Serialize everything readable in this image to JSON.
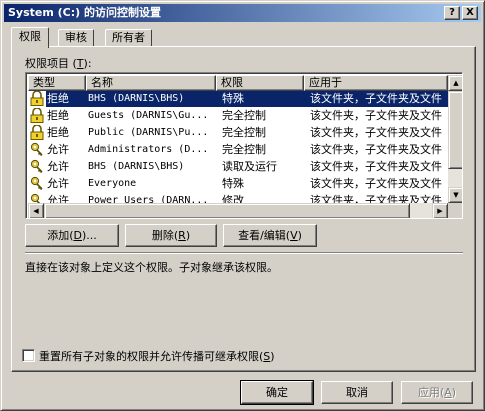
{
  "window": {
    "title": "System (C:) 的访问控制设置",
    "help_glyph": "?",
    "close_glyph": "X"
  },
  "tabs": [
    {
      "label": "权限",
      "active": true
    },
    {
      "label": "审核",
      "active": false
    },
    {
      "label": "所有者",
      "active": false
    }
  ],
  "permissions": {
    "list_label_prefix": "权限项目 (",
    "list_label_key": "T",
    "list_label_suffix": "):",
    "columns": [
      "类型",
      "名称",
      "权限",
      "应用于"
    ],
    "rows": [
      {
        "icon": "lock-icon",
        "type": "拒绝",
        "name": "BHS (DARNIS\\BHS)",
        "permission": "特殊",
        "apply_to": "该文件夹，子文件夹及文件",
        "selected": true
      },
      {
        "icon": "lock-icon",
        "type": "拒绝",
        "name": "Guests (DARNIS\\Gu...",
        "permission": "完全控制",
        "apply_to": "该文件夹，子文件夹及文件",
        "selected": false
      },
      {
        "icon": "lock-icon",
        "type": "拒绝",
        "name": "Public (DARNIS\\Pu...",
        "permission": "完全控制",
        "apply_to": "该文件夹，子文件夹及文件",
        "selected": false
      },
      {
        "icon": "key-icon",
        "type": "允许",
        "name": "Administrators (D...",
        "permission": "完全控制",
        "apply_to": "该文件夹，子文件夹及文件",
        "selected": false
      },
      {
        "icon": "key-icon",
        "type": "允许",
        "name": "BHS (DARNIS\\BHS)",
        "permission": "读取及运行",
        "apply_to": "该文件夹，子文件夹及文件",
        "selected": false
      },
      {
        "icon": "key-icon",
        "type": "允许",
        "name": "Everyone",
        "permission": "特殊",
        "apply_to": "该文件夹，子文件夹及文件",
        "selected": false
      },
      {
        "icon": "key-icon",
        "type": "允许",
        "name": "Power Users (DARN...",
        "permission": "修改",
        "apply_to": "该文件夹，子文件夹及文件",
        "selected": false
      }
    ]
  },
  "buttons": {
    "add": {
      "text": "添加",
      "key": "D",
      "suffix": "..."
    },
    "remove": {
      "text": "删除",
      "key": "R",
      "suffix": ""
    },
    "view_edit": {
      "text": "查看/编辑",
      "key": "V",
      "suffix": ""
    },
    "ok": "确定",
    "cancel": "取消",
    "apply": {
      "text": "应用",
      "key": "A"
    }
  },
  "description": "直接在该对象上定义这个权限。子对象继承该权限。",
  "reset_checkbox": {
    "text": "重置所有子对象的权限并允许传播可继承权限",
    "key": "S",
    "checked": false
  },
  "colors": {
    "title_start": "#0a246a",
    "title_end": "#a6caf0",
    "selection": "#0a246a",
    "face": "#d4d0c8"
  }
}
